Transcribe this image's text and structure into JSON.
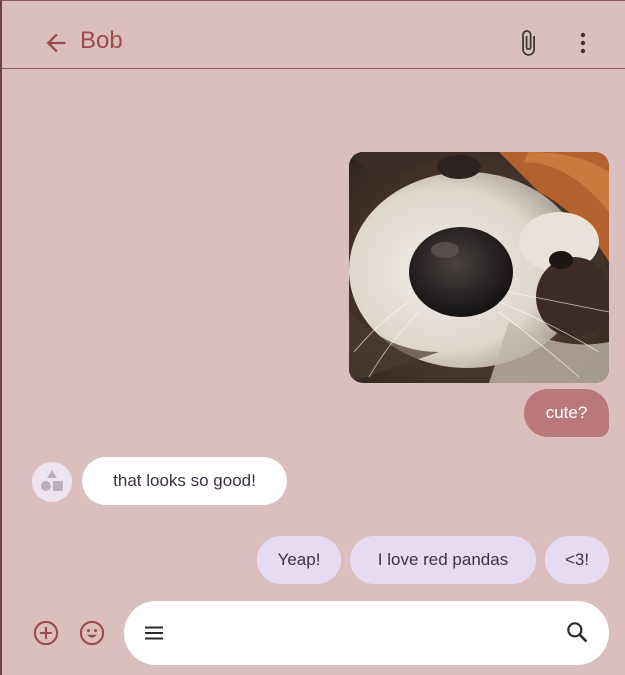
{
  "header": {
    "title": "Bob",
    "icons": {
      "back": "arrow-back-icon",
      "attach": "paperclip-icon",
      "more": "more-vert-icon"
    }
  },
  "messages": [
    {
      "id": "photo",
      "type": "image",
      "sender": "me",
      "description_icon": "red-panda-photo"
    },
    {
      "id": "m1",
      "type": "text",
      "sender": "me",
      "text": "cute?"
    },
    {
      "id": "m2",
      "type": "text",
      "sender": "Bob",
      "text": "that looks so good!"
    },
    {
      "id": "m3",
      "type": "text",
      "sender": "me",
      "text": "Yeap!"
    },
    {
      "id": "m4",
      "type": "text",
      "sender": "me",
      "text": "I love red pandas"
    },
    {
      "id": "m5",
      "type": "text",
      "sender": "me",
      "text": "<3!"
    }
  ],
  "composer": {
    "icons": {
      "add": "add-circle-icon",
      "emoji": "emoji-icon",
      "menu": "menu-icon",
      "search": "search-icon"
    }
  },
  "colors": {
    "background": "#dbbfbf",
    "accent": "#9c4a4a",
    "outgoing_red": "#bb7878",
    "outgoing_lavender": "#e7dbf4",
    "incoming": "#ffffff"
  }
}
